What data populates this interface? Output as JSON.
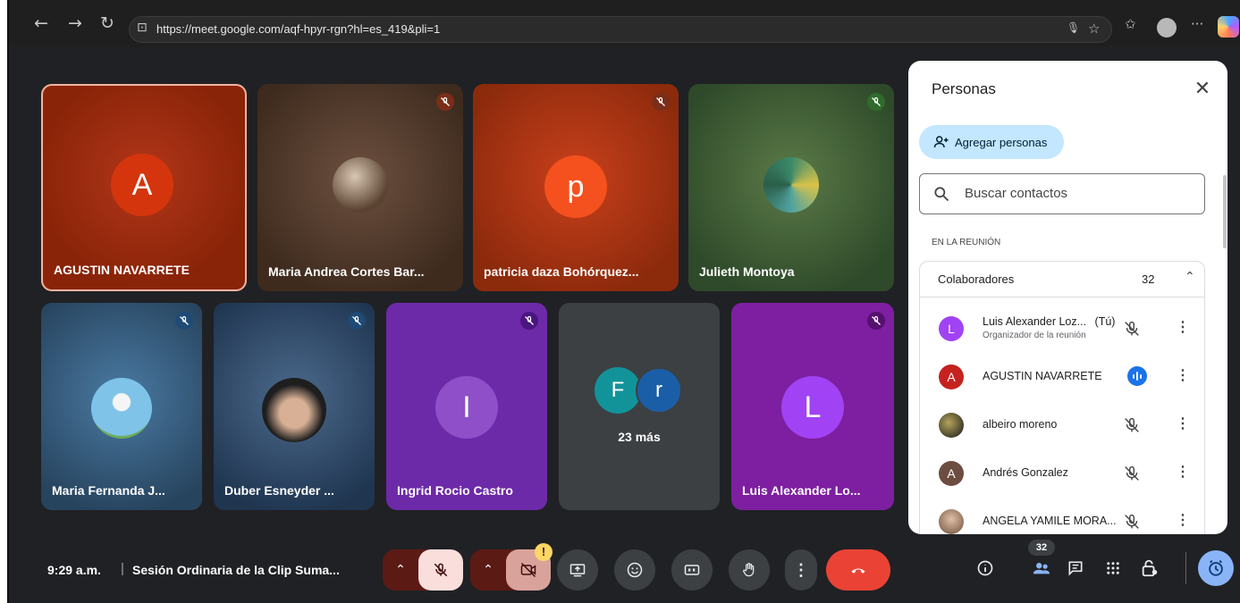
{
  "browser": {
    "url": "https://meet.google.com/aqf-hpyr-rgn?hl=es_419&pli=1"
  },
  "tiles": [
    {
      "name": "AGUSTIN NAVARRETE",
      "avatar_letter": "A",
      "muted": false,
      "speaking": true
    },
    {
      "name": "Maria Andrea Cortes Bar...",
      "avatar": "photo",
      "muted": true
    },
    {
      "name": "patricia daza Bohórquez...",
      "avatar_letter": "p",
      "muted": true
    },
    {
      "name": "Julieth Montoya",
      "avatar": "photo",
      "muted": true
    },
    {
      "name": "Maria Fernanda J...",
      "avatar": "ferris-wheel",
      "muted": true
    },
    {
      "name": "Duber Esneyder ...",
      "avatar": "photo",
      "muted": true
    },
    {
      "name": "Ingrid Rocio Castro",
      "avatar_letter": "I",
      "muted": true
    },
    {
      "name": "23 más",
      "avatar_letters": [
        "F",
        "r"
      ],
      "is_overflow": true
    },
    {
      "name": "Luis Alexander Lo...",
      "avatar_letter": "L",
      "muted": true
    }
  ],
  "panel": {
    "title": "Personas",
    "add_button": "Agregar personas",
    "search_placeholder": "Buscar contactos",
    "section_label": "EN LA REUNIÓN",
    "group_label": "Colaboradores",
    "group_count": "32",
    "people": [
      {
        "name": "Luis Alexander Loz...",
        "suffix": "(Tú)",
        "subtitle": "Organizador de la reunión",
        "avatar_letter": "L",
        "avatar_color": "#a142f4",
        "state": "muted"
      },
      {
        "name": "AGUSTIN NAVARRETE",
        "avatar_letter": "A",
        "avatar_color": "#c5221f",
        "state": "speaking"
      },
      {
        "name": "albeiro moreno",
        "avatar": "photo",
        "state": "muted"
      },
      {
        "name": "Andrés Gonzalez",
        "avatar_letter": "A",
        "avatar_color": "#6d4c41",
        "state": "muted"
      },
      {
        "name": "ANGELA YAMILE MORA...",
        "avatar": "photo",
        "state": "muted"
      }
    ]
  },
  "bottom": {
    "time": "9:29 a.m.",
    "separator": "|",
    "meeting_title": "Sesión Ordinaria de la Clip Suma...",
    "people_badge": "32",
    "warning": "!",
    "icons": [
      "mic-off",
      "camera-off",
      "present",
      "emoji",
      "captions",
      "raise-hand",
      "more",
      "end-call",
      "info",
      "people",
      "chat",
      "activities",
      "host-controls",
      "timer"
    ]
  },
  "colors": {
    "accent": "#1a73e8",
    "end_call": "#ea4335",
    "muted_ctrl": "#f9dedc"
  }
}
